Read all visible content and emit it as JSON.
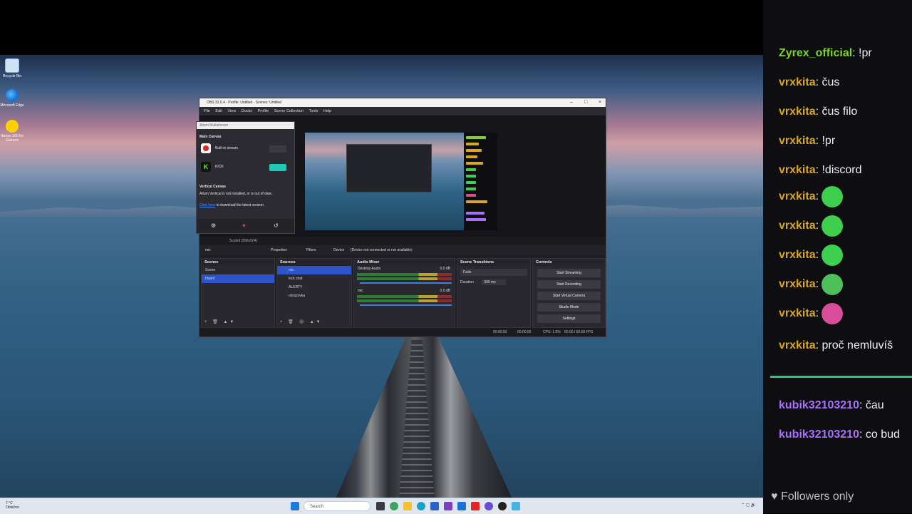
{
  "desktop": {
    "icons": [
      {
        "label": "Recycle Bin",
        "icon": "recycle-bin-icon"
      },
      {
        "label": "Microsoft Edge",
        "icon": "edge-icon"
      },
      {
        "label": "Norton 360 for Gamers",
        "icon": "norton-icon"
      }
    ]
  },
  "taskbar": {
    "weather_line1": "7 °C",
    "weather_line2": "Oblačno",
    "search_placeholder": "Search",
    "icons": [
      "start-icon",
      "search-icon",
      "taskview-icon",
      "widgets-icon",
      "explorer-icon",
      "edge-icon",
      "store-icon",
      "mail-icon",
      "youtube-icon",
      "obs-icon",
      "notepad-icon"
    ]
  },
  "obs": {
    "title": "OBS 32.0.4 - Profile: Untitled - Scenes: Untitled",
    "menu": [
      "File",
      "Edit",
      "View",
      "Docks",
      "Profile",
      "Scene Collection",
      "Tools",
      "Help"
    ],
    "aitum": {
      "header": "Aitum Multistream",
      "main_canvas": "Main Canvas",
      "outputs": [
        {
          "label": "Built-in stream",
          "color": "#e3252a"
        },
        {
          "label": "KICK",
          "color": "#53fc18"
        }
      ],
      "vertical_canvas": "Vertical Canvas",
      "vertical_msg": "Aitum Vertical is not installed, or is out of date.",
      "link_text": "Click here",
      "link_rest": "to download the latest version."
    },
    "scale_label": "Scaled (896x504)",
    "props_bar": {
      "source": "mic",
      "properties": "Properties",
      "filters": "Filters",
      "device_label": "Device",
      "device_value": "(Device not connected or not available)"
    },
    "scenes": {
      "title": "Scenes",
      "items": [
        "Scene",
        "hlavní"
      ]
    },
    "sources": {
      "title": "Sources",
      "items": [
        "mic",
        "kick chat",
        "ALERTY",
        "obrazovka"
      ]
    },
    "audio": {
      "title": "Audio Mixer",
      "channels": [
        {
          "name": "Desktop Audio",
          "db": "0.0 dB"
        },
        {
          "name": "mic",
          "db": "0.0 dB"
        }
      ]
    },
    "transitions": {
      "title": "Scene Transitions",
      "type": "Fade",
      "duration_label": "Duration",
      "duration_value": "300 ms"
    },
    "controls": {
      "title": "Controls",
      "buttons": [
        "Start Streaming",
        "Start Recording",
        "Start Virtual Camera",
        "Studio Mode",
        "Settings"
      ]
    },
    "status": {
      "time1": "00:00:00",
      "time2": "00:00:00",
      "cpu": "CPU: 1.6%",
      "fps": "60.00 / 60.00 FPS"
    }
  },
  "chat": {
    "accent": "#2ec27a",
    "messages": [
      {
        "user": "Zyrex_official",
        "user_color": "#7ed321",
        "text": "!pr"
      },
      {
        "user": "vrxkita",
        "user_color": "#daa520",
        "text": "čus"
      },
      {
        "user": "vrxkita",
        "user_color": "#daa520",
        "text": "čus filo"
      },
      {
        "user": "vrxkita",
        "user_color": "#daa520",
        "text": "!pr"
      },
      {
        "user": "vrxkita",
        "user_color": "#daa520",
        "text": "!discord"
      },
      {
        "user": "vrxkita",
        "user_color": "#daa520",
        "emote": "green-blob-emote"
      },
      {
        "user": "vrxkita",
        "user_color": "#daa520",
        "emote": "green-smile-emote"
      },
      {
        "user": "vrxkita",
        "user_color": "#daa520",
        "emote": "green-blob-emote"
      },
      {
        "user": "vrxkita",
        "user_color": "#daa520",
        "emote": "green-sick-emote"
      },
      {
        "user": "vrxkita",
        "user_color": "#daa520",
        "emote": "pink-monster-emote"
      },
      {
        "user": "vrxkita",
        "user_color": "#daa520",
        "text": "proč nemluvíš"
      },
      {
        "user": "kubik32103210",
        "user_color": "#a970ff",
        "text": "čau"
      },
      {
        "user": "kubik32103210",
        "user_color": "#a970ff",
        "text": "co bud"
      }
    ],
    "footer": "Followers only"
  }
}
